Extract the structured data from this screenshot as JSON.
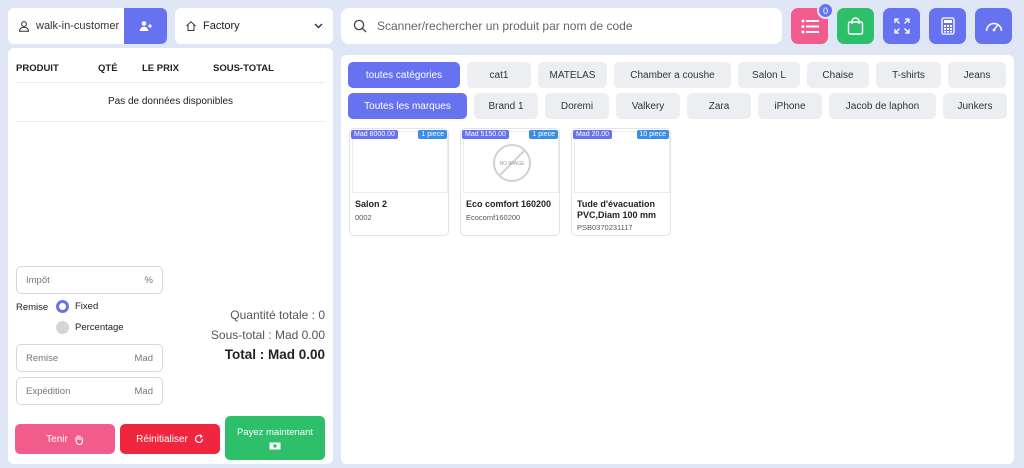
{
  "customer": {
    "name": "walk-in-customer"
  },
  "warehouse": {
    "selected": "Factory"
  },
  "search": {
    "placeholder": "Scanner/rechercher un produit par nom de code"
  },
  "toolbar": {
    "list_badge": "0"
  },
  "colors": {
    "accent": "#6772f0",
    "pink": "#f25c8c",
    "green": "#2dbf6a",
    "red": "#f0263e"
  },
  "cart": {
    "headers": {
      "product": "PRODUIT",
      "qty": "QTÉ",
      "price": "LE PRIX",
      "subtotal": "SOUS-TOTAL"
    },
    "empty_message": "Pas de données disponibles"
  },
  "form": {
    "tax_placeholder": "Impôt",
    "tax_unit": "%",
    "discount_label": "Remise",
    "discount_options": [
      "Fixed",
      "Percentage"
    ],
    "discount_selected": "Fixed",
    "discount_placeholder": "Remise",
    "discount_unit": "Mad",
    "shipping_placeholder": "Expédition",
    "shipping_unit": "Mad"
  },
  "totals": {
    "quantity": "Quantité totale : 0",
    "subtotal": "Sous-total : Mad 0.00",
    "total": "Total : Mad 0.00"
  },
  "actions": {
    "hold": "Tenir",
    "reset": "Réinitialiser",
    "pay": "Payez maintenant"
  },
  "categories": [
    "toutes catégories",
    "cat1",
    "MATELAS",
    "Chamber a coushe",
    "Salon L",
    "Chaise",
    "T-shirts",
    "Jeans"
  ],
  "brands": [
    "Toutes les marques",
    "Brand 1",
    "Doremi",
    "Valkery",
    "Zara",
    "iPhone",
    "Jacob de laphon",
    "Junkers"
  ],
  "products": [
    {
      "price": "Mad 8000.00",
      "qty": "1 piece",
      "name": "Salon 2",
      "code": "0002",
      "image": ""
    },
    {
      "price": "Mad 5150.00",
      "qty": "1 piece",
      "name": "Eco comfort 160200",
      "code": "Ecocomf160200",
      "image": "NO IMAGE"
    },
    {
      "price": "Mad 20.00",
      "qty": "10 piece",
      "name": "Tude d'évacuation PVC,Diam 100 mm",
      "code": "PSB0370231117",
      "image": ""
    }
  ]
}
